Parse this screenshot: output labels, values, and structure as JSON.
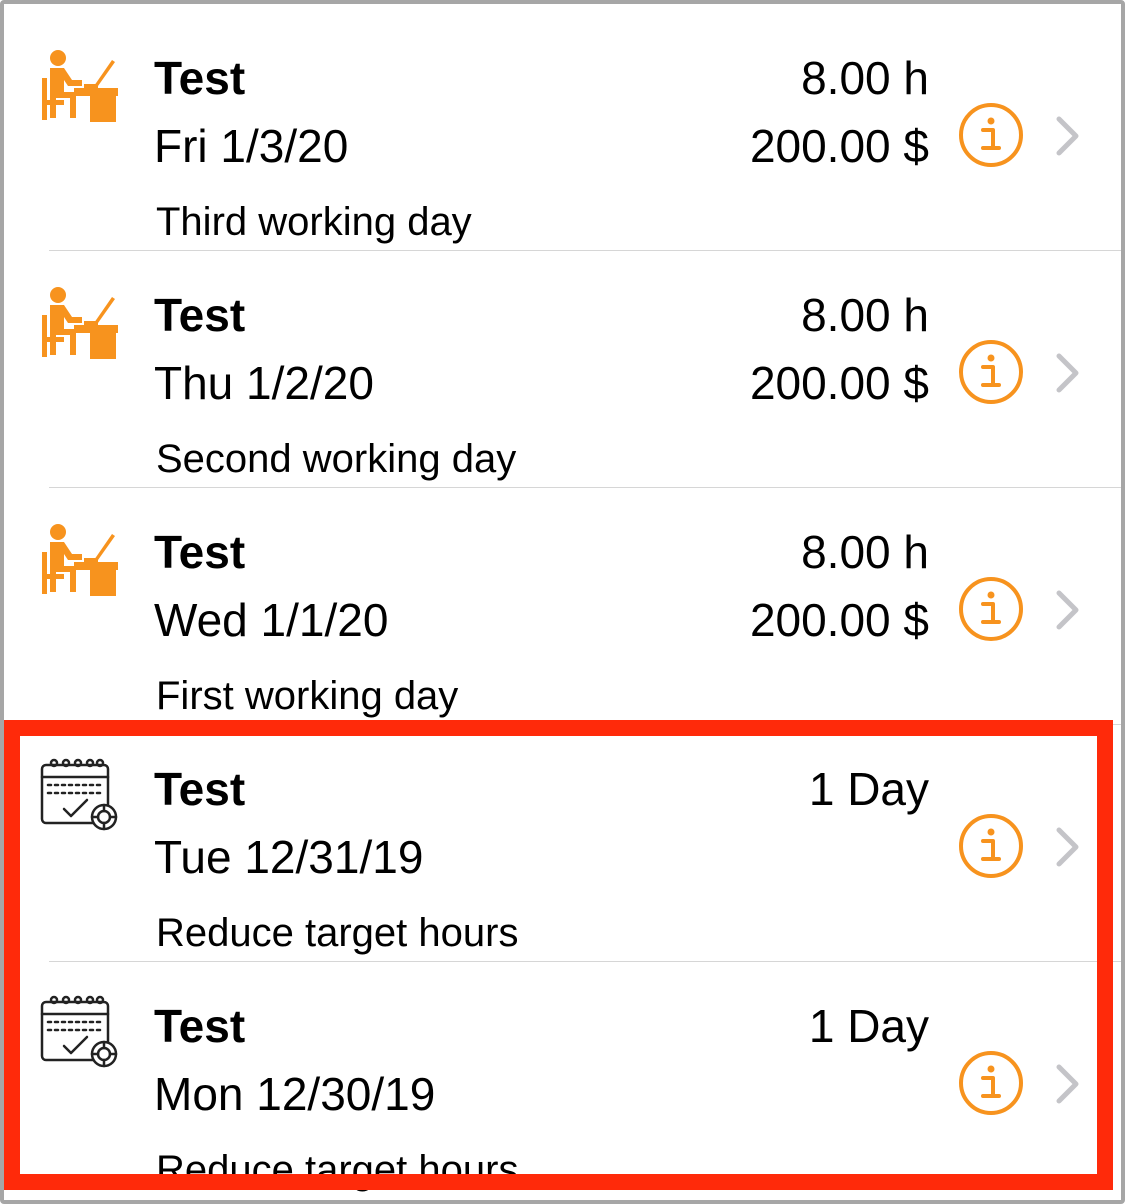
{
  "colors": {
    "accent": "#f7931e",
    "highlight": "#ff2a0a",
    "separator": "#d6d6d6",
    "chevron": "#c4c4c8"
  },
  "entries": [
    {
      "icon": "worker-desk-icon",
      "title": "Test",
      "date": "Fri 1/3/20",
      "note": "Third working day",
      "amount_primary": "8.00 h",
      "amount_secondary": "200.00 $"
    },
    {
      "icon": "worker-desk-icon",
      "title": "Test",
      "date": "Thu 1/2/20",
      "note": "Second working day",
      "amount_primary": "8.00 h",
      "amount_secondary": "200.00 $"
    },
    {
      "icon": "worker-desk-icon",
      "title": "Test",
      "date": "Wed 1/1/20",
      "note": "First working day",
      "amount_primary": "8.00 h",
      "amount_secondary": "200.00 $"
    },
    {
      "icon": "calendar-check-icon",
      "title": "Test",
      "date": "Tue 12/31/19",
      "note": "Reduce target hours",
      "amount_primary": "1 Day",
      "amount_secondary": ""
    },
    {
      "icon": "calendar-check-icon",
      "title": "Test",
      "date": "Mon 12/30/19",
      "note": "Reduce target hours",
      "amount_primary": "1 Day",
      "amount_secondary": ""
    }
  ]
}
